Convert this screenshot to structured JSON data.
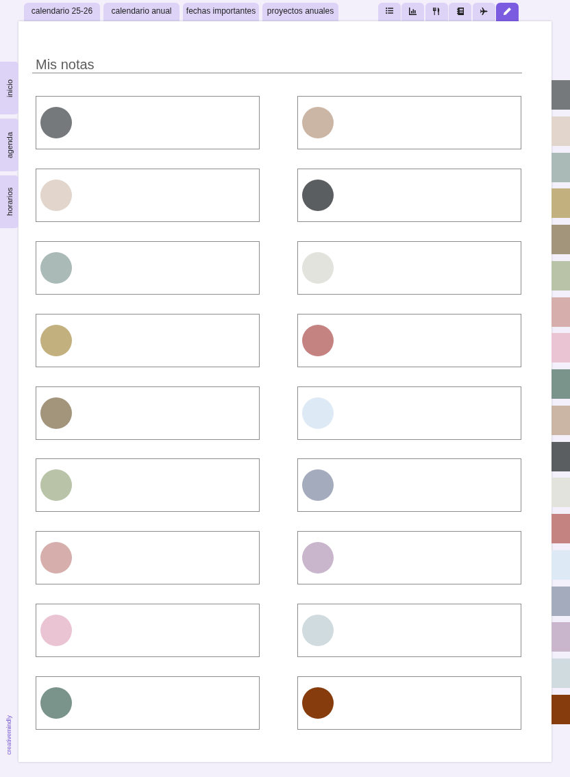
{
  "top_tabs": [
    {
      "label": "calendario 25-26",
      "selected": false
    },
    {
      "label": "calendario anual",
      "selected": false
    },
    {
      "label": "fechas importantes",
      "selected": false
    },
    {
      "label": "proyectos anuales",
      "selected": false
    }
  ],
  "icon_tabs": [
    {
      "selected": false
    },
    {
      "selected": false
    },
    {
      "selected": false
    },
    {
      "selected": false
    },
    {
      "selected": false
    },
    {
      "selected": true
    }
  ],
  "side_tabs": [
    {
      "label": "inicio",
      "selected": false
    },
    {
      "label": "agenda",
      "selected": false
    },
    {
      "label": "horarios",
      "selected": false
    }
  ],
  "brand": "creativemindly",
  "page": {
    "title": "Mis notas",
    "note_columns": [
      {
        "notes": [
          {
            "color": "#76797c"
          },
          {
            "color": "#e1d5cc"
          },
          {
            "color": "#a9bab7"
          },
          {
            "color": "#c3b07f"
          },
          {
            "color": "#a3957c"
          },
          {
            "color": "#b8c3a7"
          },
          {
            "color": "#d6afac"
          },
          {
            "color": "#ebc4d3"
          },
          {
            "color": "#7a948b"
          }
        ]
      },
      {
        "notes": [
          {
            "color": "#cbb6a6"
          },
          {
            "color": "#5b5e61"
          },
          {
            "color": "#e1e3dc"
          },
          {
            "color": "#c48281"
          },
          {
            "color": "#dde9f5"
          },
          {
            "color": "#a3abbd"
          },
          {
            "color": "#c9b6cd"
          },
          {
            "color": "#cfdbde"
          },
          {
            "color": "#873c0e"
          }
        ]
      }
    ]
  },
  "color_tabs": [
    {
      "color": "#76797c"
    },
    {
      "color": "#e1d5cc"
    },
    {
      "color": "#a9bab7"
    },
    {
      "color": "#c3b07f"
    },
    {
      "color": "#a3957c"
    },
    {
      "color": "#b8c3a7"
    },
    {
      "color": "#d6afac"
    },
    {
      "color": "#ebc4d3"
    },
    {
      "color": "#7a948b"
    },
    {
      "color": "#cbb6a6"
    },
    {
      "color": "#5b5e61"
    },
    {
      "color": "#e1e3dc"
    },
    {
      "color": "#c48281"
    },
    {
      "color": "#dde9f5"
    },
    {
      "color": "#a3abbd"
    },
    {
      "color": "#c9b6cd"
    },
    {
      "color": "#cfdbde"
    },
    {
      "color": "#873c0e"
    }
  ]
}
